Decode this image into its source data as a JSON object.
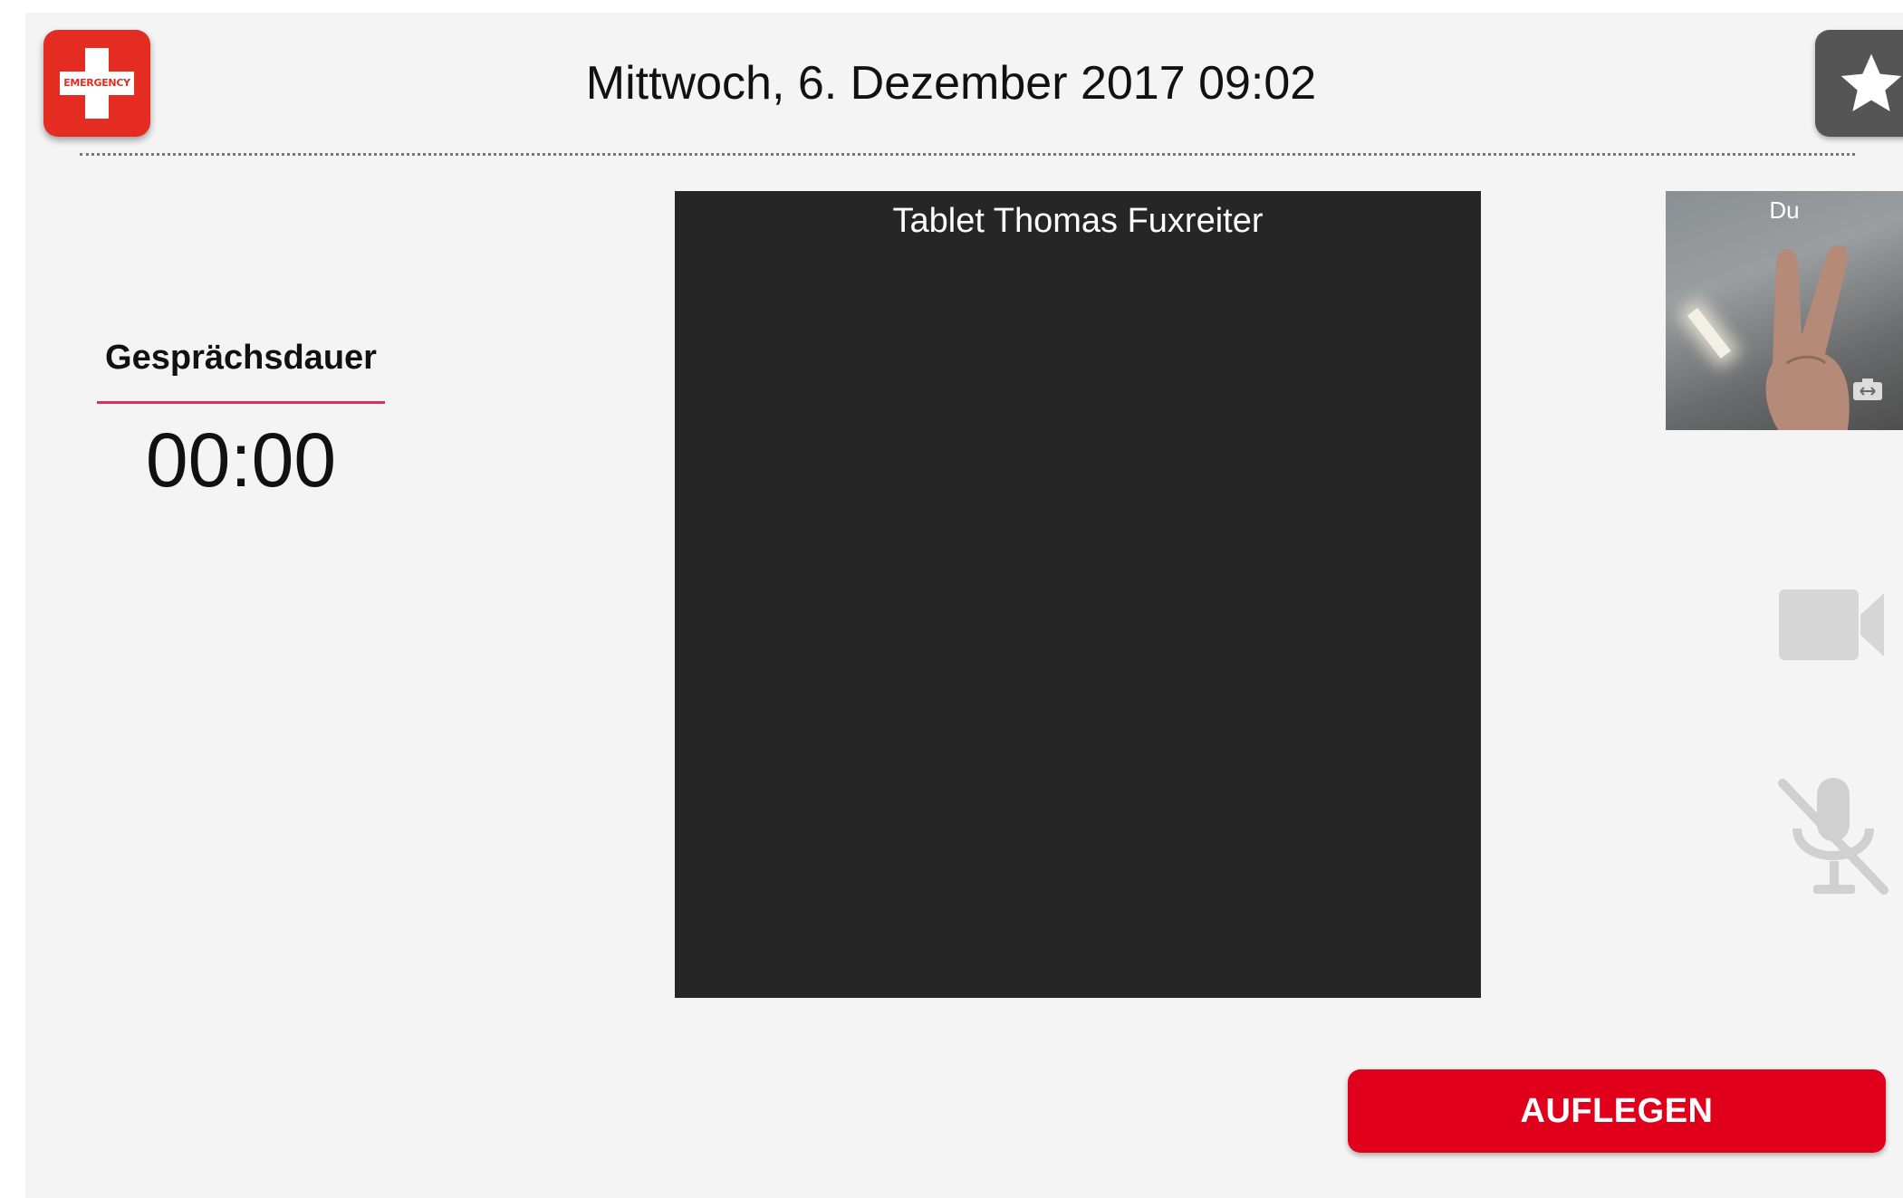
{
  "header": {
    "emergency_button": {
      "text": "EMERGENCY",
      "icon": "emergency-cross-icon",
      "color": "#e42c22"
    },
    "datetime": "Mittwoch, 6. Dezember 2017 09:02",
    "favorite_button": {
      "icon": "star-icon",
      "color": "#555555"
    }
  },
  "call": {
    "duration_label": "Gesprächsdauer",
    "duration_value": "00:00",
    "remote_video": {
      "caller_name": "Tablet Thomas Fuxreiter"
    },
    "self_video": {
      "label": "Du",
      "switch_icon": "switch-camera-icon"
    },
    "controls": {
      "video_icon": "video-camera-icon",
      "mic_icon": "microphone-muted-icon"
    },
    "hangup_label": "AUFLEGEN",
    "accent_color": "#e0001b",
    "underline_color": "#d8305a"
  }
}
